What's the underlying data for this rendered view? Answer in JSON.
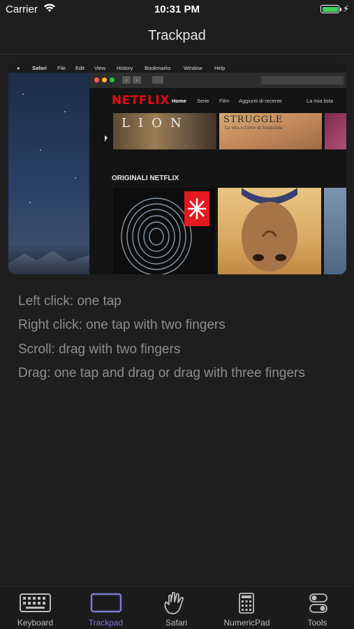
{
  "status_bar": {
    "carrier": "Carrier",
    "time": "10:31 PM"
  },
  "nav": {
    "title": "Trackpad"
  },
  "preview": {
    "menubar": [
      "Safari",
      "File",
      "Edit",
      "View",
      "History",
      "Bookmarks",
      "Window",
      "Help"
    ],
    "netflix_logo": "NETFLIX",
    "netflix_nav": [
      "Home",
      "Serie",
      "Film",
      "Aggiunti di recente",
      "La mia lista"
    ],
    "row1_titles": {
      "lion": "LION",
      "struggle": "STRUGGLE",
      "struggle_sub": "La vita e l'arte di Szukalski"
    },
    "section_title": "ORIGINALI NETFLIX"
  },
  "instructions": [
    "Left click: one tap",
    "Right click: one tap with two fingers",
    "Scroll: drag with two fingers",
    "Drag: one tap and drag or drag with three fingers"
  ],
  "tabs": [
    {
      "label": "Keyboard",
      "icon": "keyboard-icon"
    },
    {
      "label": "Trackpad",
      "icon": "trackpad-icon",
      "active": true
    },
    {
      "label": "Safari",
      "icon": "hand-icon"
    },
    {
      "label": "NumericPad",
      "icon": "numericpad-icon"
    },
    {
      "label": "Tools",
      "icon": "toggles-icon"
    }
  ],
  "colors": {
    "accent": "#7b7bd8",
    "battery": "#3fd35a",
    "netflix_red": "#e50914",
    "background": "#1e1e1e"
  }
}
